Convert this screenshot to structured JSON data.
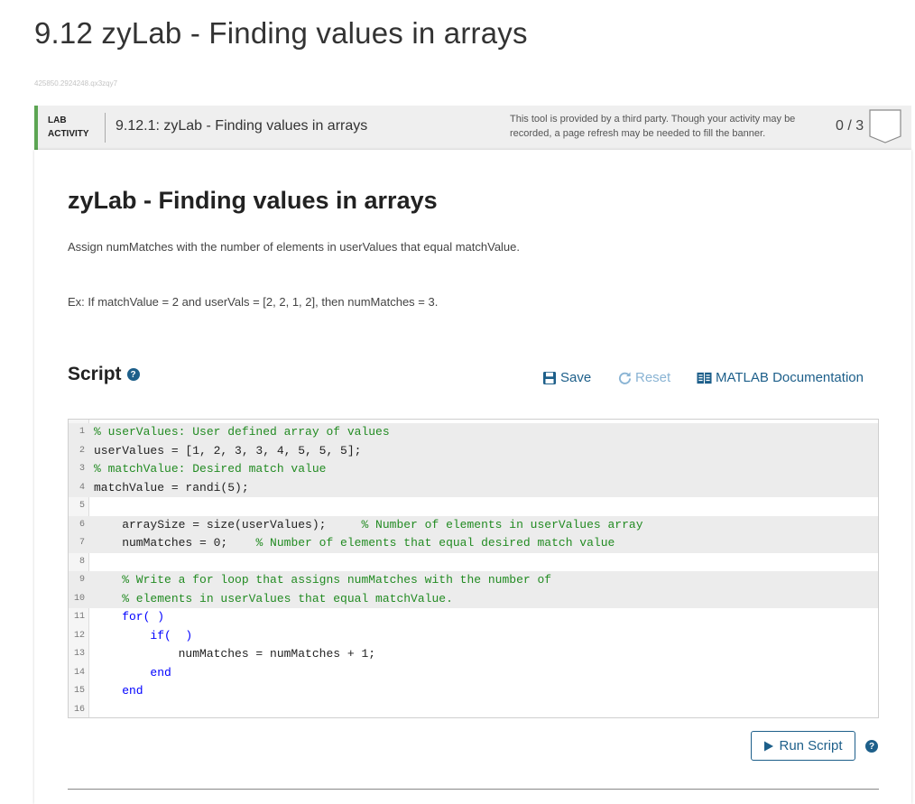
{
  "page": {
    "title": "9.12 zyLab - Finding values in arrays",
    "activity_id": "425850.2924248.qx3zqy7"
  },
  "banner": {
    "type_line1": "LAB",
    "type_line2": "ACTIVITY",
    "title": "9.12.1: zyLab - Finding values in arrays",
    "note": "This tool is provided by a third party. Though your activity may be recorded, a page refresh may be needed to fill the banner.",
    "score": "0 / 3",
    "accent_color": "#5ca553"
  },
  "lab": {
    "heading": "zyLab - Finding values in arrays",
    "instruction": "Assign numMatches with the number of elements in userValues that equal matchValue.",
    "example": "Ex: If matchValue = 2 and userVals = [2, 2, 1, 2], then numMatches = 3."
  },
  "script": {
    "title": "Script",
    "help_icon": "question-circle-icon",
    "save_label": "Save",
    "reset_label": "Reset",
    "docs_label": "MATLAB Documentation"
  },
  "editor": {
    "line_numbers": [
      "1",
      "2",
      "3",
      "4",
      "5",
      "6",
      "7",
      "8",
      "9",
      "10",
      "11",
      "12",
      "13",
      "14",
      "15",
      "16"
    ],
    "lines": [
      {
        "code": "% userValues: User defined array of values",
        "comment": ""
      },
      {
        "code": "userValues = [1, 2, 3, 3, 4, 5, 5, 5];",
        "comment": ""
      },
      {
        "code": "% matchValue: Desired match value",
        "comment": ""
      },
      {
        "code": "matchValue = randi(5);",
        "comment": ""
      },
      {
        "code": "",
        "comment": ""
      },
      {
        "code": "    arraySize = size(userValues);     ",
        "comment": "% Number of elements in userValues array"
      },
      {
        "code": "    numMatches = 0;    ",
        "comment": "% Number of elements that equal desired match value"
      },
      {
        "code": "",
        "comment": ""
      },
      {
        "code": "    % Write a for loop that assigns numMatches with the number of",
        "comment": ""
      },
      {
        "code": "    % elements in userValues that equal matchValue.",
        "comment": ""
      },
      {
        "code": "    for( )",
        "comment": ""
      },
      {
        "code": "        if(  )",
        "comment": ""
      },
      {
        "code": "            numMatches = numMatches + 1;",
        "comment": ""
      },
      {
        "code": "        end",
        "comment": ""
      },
      {
        "code": "    end",
        "comment": ""
      },
      {
        "code": "",
        "comment": ""
      }
    ]
  },
  "actions": {
    "run_label": "Run Script"
  },
  "colors": {
    "link": "#1d5f8a",
    "reset_disabled": "#8ab4d4",
    "comment": "#228b22",
    "keyword": "#0000ff"
  }
}
